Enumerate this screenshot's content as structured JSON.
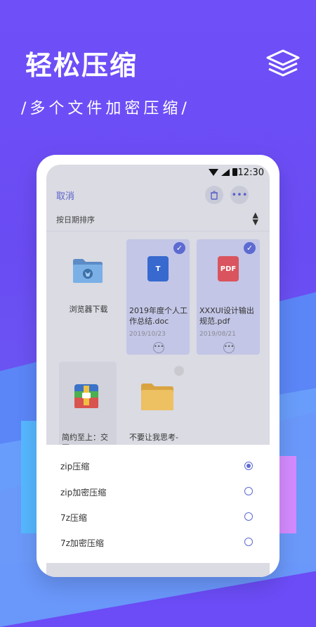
{
  "promo": {
    "title": "轻松压缩",
    "subtitle": "/多个文件加密压缩/",
    "icon": "layers-icon"
  },
  "status_bar": {
    "time": "12:30"
  },
  "toolbar": {
    "cancel": "取消",
    "delete_icon": "trash-icon",
    "more_icon": "more-icon"
  },
  "sort": {
    "label": "按日期排序"
  },
  "files": [
    {
      "name": "浏览器下载",
      "date": "",
      "type": "folder",
      "selected": false
    },
    {
      "name": "2019年度个人工作总结.doc",
      "date": "2019/10/23",
      "type": "doc",
      "badge": "T",
      "selected": true
    },
    {
      "name": "XXXUI设计输出规范.pdf",
      "date": "2019/08/21",
      "type": "pdf",
      "badge": "PDF",
      "selected": true
    },
    {
      "name": "简约至上：交互",
      "date": "",
      "type": "app",
      "selected": false
    },
    {
      "name": "不要让我思考-",
      "date": "",
      "type": "folder",
      "selected": false
    }
  ],
  "options": [
    {
      "label": "zip压缩",
      "checked": true
    },
    {
      "label": "zip加密压缩",
      "checked": false
    },
    {
      "label": "7z压缩",
      "checked": false
    },
    {
      "label": "7z加密压缩",
      "checked": false
    }
  ],
  "colors": {
    "accent": "#5c6ad1",
    "background": "#6b4cf6"
  }
}
